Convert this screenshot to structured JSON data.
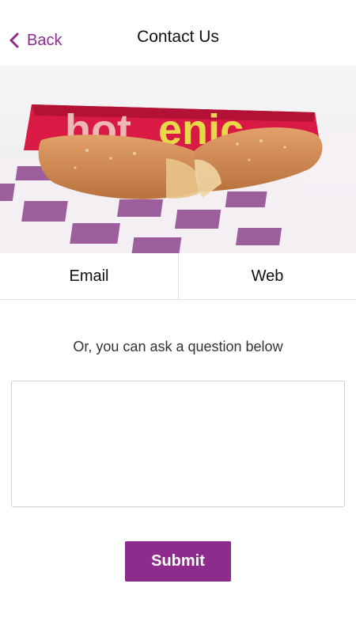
{
  "header": {
    "back_label": "Back",
    "title": "Contact Us"
  },
  "hero": {
    "wrapper_text": "hotenic",
    "icon": "apple-pie-photo"
  },
  "contact_options": [
    {
      "label": "Email"
    },
    {
      "label": "Web"
    }
  ],
  "prompt": "Or, you can ask a question below",
  "question_input": {
    "value": "",
    "placeholder": ""
  },
  "submit_label": "Submit",
  "colors": {
    "accent": "#8e2c8e",
    "divider": "#e2e2e2",
    "wrapper_red": "#d91a45",
    "wrapper_yellow": "#e8d94a"
  }
}
